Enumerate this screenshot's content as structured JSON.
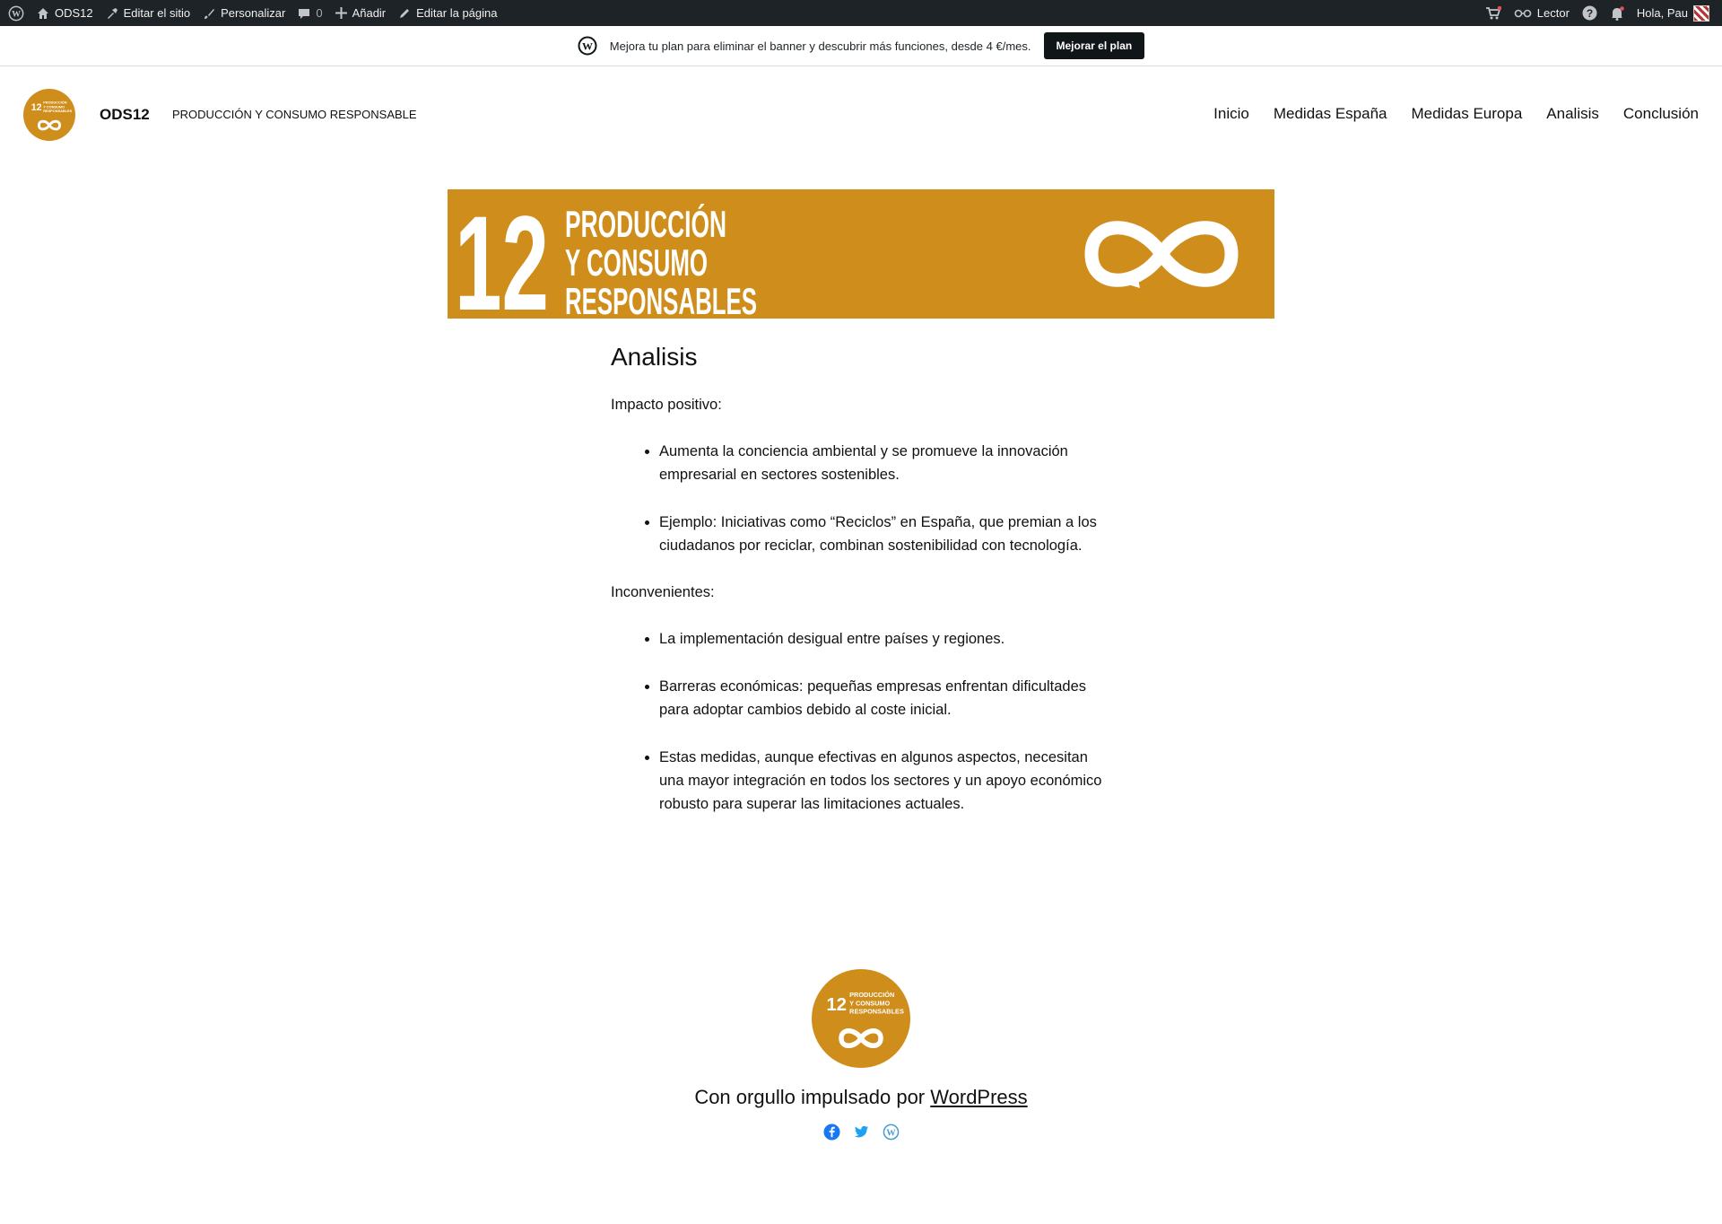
{
  "adminbar": {
    "site": "ODS12",
    "edit_site": "Editar el sitio",
    "customize": "Personalizar",
    "comments_count": "0",
    "add_new": "Añadir",
    "edit_page": "Editar la página",
    "reader": "Lector",
    "greeting": "Hola, Pau"
  },
  "banner": {
    "message": "Mejora tu plan para eliminar el banner y descubrir más funciones, desde 4 €/mes.",
    "button": "Mejorar el plan"
  },
  "header": {
    "site_title": "ODS12",
    "tagline": "PRODUCCIÓN Y CONSUMO RESPONSABLE",
    "nav": [
      "Inicio",
      "Medidas España",
      "Medidas Europa",
      "Analisis",
      "Conclusión"
    ]
  },
  "hero": {
    "number": "12",
    "line1": "PRODUCCIÓN",
    "line2": "Y CONSUMO",
    "line3": "RESPONSABLES",
    "color": "#cf8d1b"
  },
  "logo": {
    "number": "12",
    "line1": "PRODUCCIÓN",
    "line2": "Y CONSUMO",
    "line3": "RESPONSABLES"
  },
  "content": {
    "title": "Analisis",
    "positive_heading": "Impacto positivo:",
    "positive_items": [
      "Aumenta la conciencia ambiental y se promueve la innovación empresarial en sectores sostenibles.",
      "Ejemplo: Iniciativas como “Reciclos” en España, que premian a los ciudadanos por reciclar, combinan sostenibilidad con tecnología."
    ],
    "negative_heading": "Inconvenientes:",
    "negative_items": [
      "La implementación desigual entre países y regiones.",
      "Barreras económicas: pequeñas empresas enfrentan dificultades para adoptar cambios debido al coste inicial.",
      "Estas medidas, aunque efectivas en algunos aspectos, necesitan una mayor integración en todos los sectores y un apoyo económico robusto para superar las limitaciones actuales."
    ]
  },
  "footer": {
    "powered_prefix": "Con orgullo impulsado por",
    "powered_link": "WordPress",
    "social": [
      "facebook-icon",
      "twitter-icon",
      "wordpress-icon"
    ]
  }
}
